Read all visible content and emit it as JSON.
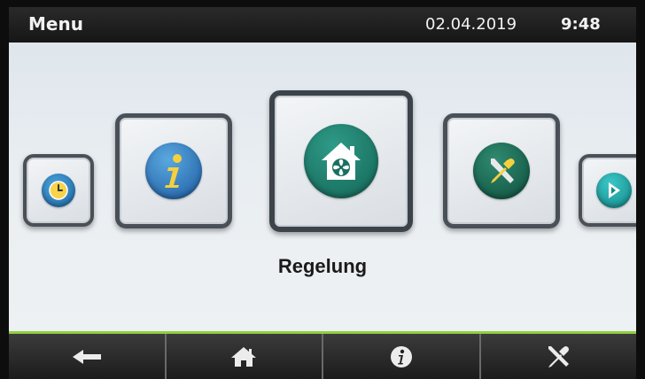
{
  "header": {
    "title": "Menu",
    "date": "02.04.2019",
    "time": "9:48"
  },
  "carousel": {
    "selected_label": "Regelung",
    "items": [
      {
        "icon": "clock-icon",
        "color": "#2f7fb8"
      },
      {
        "icon": "info-icon",
        "color": "#2f6fb0"
      },
      {
        "icon": "house-fan-icon",
        "color": "#1f7a6a",
        "selected": true
      },
      {
        "icon": "tools-icon",
        "color": "#1f6a58"
      },
      {
        "icon": "play-icon",
        "color": "#1aa0a0"
      }
    ]
  },
  "navbar": {
    "items": [
      {
        "icon": "back-arrow-icon"
      },
      {
        "icon": "home-icon"
      },
      {
        "icon": "info-icon"
      },
      {
        "icon": "tools-icon"
      }
    ]
  },
  "colors": {
    "accent_line": "#8fcf3f",
    "header_bg": "#1c1c1c"
  }
}
